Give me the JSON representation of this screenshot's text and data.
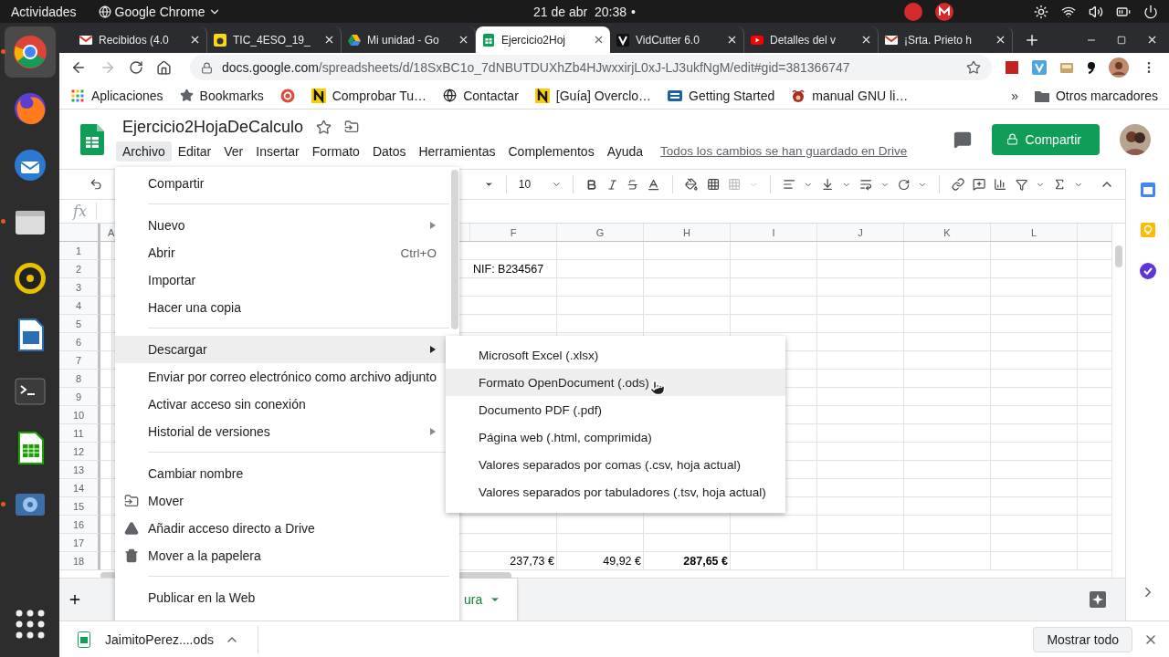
{
  "top_bar": {
    "activities": "Actividades",
    "app_menu": "Google Chrome",
    "clock": "21 de abr  20:38",
    "status_dot": "•"
  },
  "dock": [
    {
      "kind": "browser",
      "selected": true,
      "running": true
    },
    {
      "kind": "fox",
      "selected": false,
      "running": false
    },
    {
      "kind": "mail",
      "selected": false,
      "running": false
    },
    {
      "kind": "files",
      "selected": false,
      "running": true
    },
    {
      "kind": "audio",
      "selected": false,
      "running": false
    },
    {
      "kind": "writer",
      "selected": false,
      "running": false
    },
    {
      "kind": "terminal",
      "selected": false,
      "running": false
    },
    {
      "kind": "calc",
      "selected": false,
      "running": false
    },
    {
      "kind": "media",
      "selected": false,
      "running": true
    },
    {
      "kind": "apps",
      "selected": false,
      "running": false
    }
  ],
  "browser_tabs": [
    {
      "title": "Recibidos (4.0",
      "kind": "mail",
      "selected": false
    },
    {
      "title": "TIC_4ESO_19_",
      "kind": "note",
      "selected": false
    },
    {
      "title": "Mi unidad - Go",
      "kind": "drive",
      "selected": false
    },
    {
      "title": "Ejercicio2Hoj",
      "kind": "sheet",
      "selected": true
    },
    {
      "title": "VidCutter 6.0",
      "kind": "video",
      "selected": false
    },
    {
      "title": "Detalles del v",
      "kind": "tube",
      "selected": false
    },
    {
      "title": "¡Srta. Prieto h",
      "kind": "mail",
      "selected": false
    }
  ],
  "address_bar": {
    "host": "docs.google.com",
    "path": "/spreadsheets/d/18SxBC1o_7dNBUTDUXhZb4HJwxxirjL0xJ-LJ3ukfNgM/edit#gid=381366747"
  },
  "bookmarks": [
    {
      "label": "Aplicaciones",
      "kind": "apps"
    },
    {
      "label": "Bookmarks",
      "kind": "star"
    },
    {
      "kind": "badge"
    },
    {
      "label": "Comprobar Tu…",
      "kind": "n"
    },
    {
      "label": "Contactar",
      "kind": "globe"
    },
    {
      "label": "[Guía] Overclo…",
      "kind": "n"
    },
    {
      "label": "Getting Started",
      "kind": "gs"
    },
    {
      "label": "manual GNU li…",
      "kind": "gnu"
    }
  ],
  "bookmarks_more": "»",
  "other_bookmarks": "Otros marcadores",
  "sheet": {
    "title": "Ejercicio2HojaDeCalculo",
    "save_status": "Todos los cambios se han guardado en Drive",
    "share": "Compartir",
    "menubar": [
      {
        "label": "Archivo",
        "selected": true
      },
      {
        "label": "Editar",
        "selected": false
      },
      {
        "label": "Ver",
        "selected": false
      },
      {
        "label": "Insertar",
        "selected": false
      },
      {
        "label": "Formato",
        "selected": false
      },
      {
        "label": "Datos",
        "selected": false
      },
      {
        "label": "Herramientas",
        "selected": false
      },
      {
        "label": "Complementos",
        "selected": false
      },
      {
        "label": "Ayuda",
        "selected": false
      }
    ],
    "font_size": "10",
    "formula_label": "fx"
  },
  "grid": {
    "columns": [
      "A",
      "F",
      "G",
      "H",
      "I",
      "J",
      "K",
      "L"
    ],
    "rows": [
      {
        "header": "1"
      },
      {
        "header": "2",
        "cells": [
          {},
          {
            "text": "NIF: B234567",
            "bold": false
          }
        ]
      },
      {
        "header": "3"
      },
      {
        "header": "4"
      },
      {
        "header": "5"
      },
      {
        "header": "6"
      },
      {
        "header": "7"
      },
      {
        "header": "8"
      },
      {
        "header": "9"
      },
      {
        "header": "10"
      },
      {
        "header": "11"
      },
      {
        "header": "12"
      },
      {
        "header": "13"
      },
      {
        "header": "14"
      },
      {
        "header": "15"
      },
      {
        "header": "16"
      },
      {
        "header": "17"
      },
      {
        "header": "18",
        "cells": [
          {},
          {
            "text": "237,73 €",
            "bold": false
          },
          {
            "text": "49,92 €",
            "bold": false
          },
          {
            "text": "287,65 €",
            "bold": true
          }
        ]
      }
    ]
  },
  "sheet_tab": {
    "label": "ura"
  },
  "file_menu": [
    {
      "kind": "item",
      "label": "Compartir",
      "submenu": false,
      "selected": false
    },
    {
      "kind": "divider"
    },
    {
      "kind": "item",
      "label": "Nuevo",
      "submenu": true,
      "selected": false
    },
    {
      "kind": "item",
      "label": "Abrir",
      "shortcut": "Ctrl+O",
      "submenu": false,
      "selected": false
    },
    {
      "kind": "item",
      "label": "Importar",
      "submenu": false,
      "selected": false
    },
    {
      "kind": "item",
      "label": "Hacer una copia",
      "submenu": false,
      "selected": false
    },
    {
      "kind": "divider"
    },
    {
      "kind": "item",
      "label": "Descargar",
      "submenu": true,
      "selected": true
    },
    {
      "kind": "item",
      "label": "Enviar por correo electrónico como archivo adjunto",
      "submenu": false,
      "selected": false
    },
    {
      "kind": "item",
      "label": "Activar acceso sin conexión",
      "submenu": false,
      "selected": false
    },
    {
      "kind": "item",
      "label": "Historial de versiones",
      "submenu": true,
      "selected": false
    },
    {
      "kind": "divider"
    },
    {
      "kind": "item",
      "label": "Cambiar nombre",
      "submenu": false,
      "selected": false
    },
    {
      "kind": "folder_item",
      "label": "Mover",
      "submenu": false,
      "selected": false
    },
    {
      "kind": "drive_item",
      "label": "Añadir acceso directo a Drive",
      "submenu": false,
      "selected": false
    },
    {
      "kind": "trash_item",
      "label": "Mover a la papelera",
      "submenu": false,
      "selected": false
    },
    {
      "kind": "divider"
    },
    {
      "kind": "item",
      "label": "Publicar en la Web",
      "submenu": false,
      "selected": false
    }
  ],
  "download_menu": [
    {
      "label": "Microsoft Excel (.xlsx)",
      "selected": false
    },
    {
      "label": "Formato OpenDocument (.ods)",
      "selected": true
    },
    {
      "label": "Documento PDF (.pdf)",
      "selected": false
    },
    {
      "label": "Página web (.html, comprimida)",
      "selected": false
    },
    {
      "label": "Valores separados por comas (.csv, hoja actual)",
      "selected": false
    },
    {
      "label": "Valores separados por tabuladores (.tsv, hoja actual)",
      "selected": false
    }
  ],
  "download_bar": {
    "file": "JaimitoPerez....ods",
    "show_all": "Mostrar todo"
  }
}
